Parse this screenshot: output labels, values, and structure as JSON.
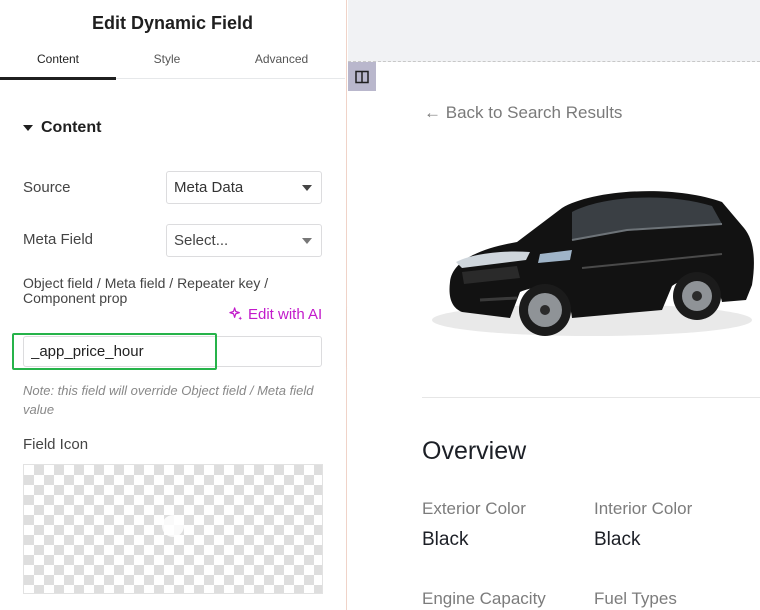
{
  "panel": {
    "title": "Edit Dynamic Field",
    "tabs": [
      {
        "label": "Content"
      },
      {
        "label": "Style"
      },
      {
        "label": "Advanced"
      }
    ],
    "section_title": "Content",
    "source": {
      "label": "Source",
      "value": "Meta Data"
    },
    "meta_field": {
      "label": "Meta Field",
      "value": "Select..."
    },
    "object_field": {
      "label": "Object field / Meta field / Repeater key / Component prop",
      "ai_link": "Edit with AI",
      "value": "_app_price_hour"
    },
    "note": "Note: this field will override Object field / Meta field value",
    "field_icon_label": "Field Icon"
  },
  "preview": {
    "back_link": "Back to Search Results",
    "overview_title": "Overview",
    "specs": [
      {
        "label": "Exterior Color",
        "value": "Black"
      },
      {
        "label": "Interior Color",
        "value": "Black"
      },
      {
        "label": "Engine Capacity",
        "value": ""
      },
      {
        "label": "Fuel Types",
        "value": ""
      }
    ]
  },
  "colors": {
    "ai_accent": "#c21acb",
    "highlight_box": "#26b34a",
    "car_body": "#111111"
  },
  "icons": [
    "caret-down-icon",
    "sparkle-icon",
    "chevron-left-icon",
    "columns-icon",
    "arrow-left-icon",
    "add-media-icon"
  ]
}
